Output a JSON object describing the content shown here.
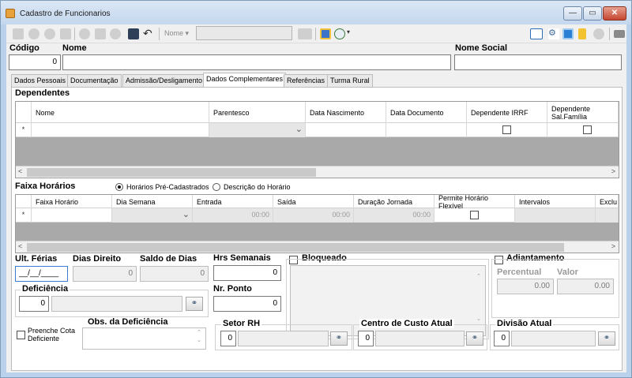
{
  "window": {
    "title": "Cadastro de Funcionarios",
    "min": "—",
    "max": "▭",
    "close": "✕"
  },
  "toolbar": {
    "nome_dropdown": "Nome ▾",
    "search_value": ""
  },
  "header": {
    "codigo_label": "Código",
    "codigo_value": "0",
    "nome_label": "Nome",
    "nome_value": "",
    "nome_social_label": "Nome Social",
    "nome_social_value": ""
  },
  "tabs": [
    "Dados Pessoais",
    "Documentação",
    "Admissão/Desligamento",
    "Dados Complementares",
    "Referências",
    "Turma Rural"
  ],
  "dependentes": {
    "title": "Dependentes",
    "columns": [
      "Nome",
      "Parentesco",
      "Data Nascimento",
      "Data Documento",
      "Dependente IRRF",
      "Dependente Sal.Família"
    ],
    "row_marker": "*"
  },
  "faixa": {
    "title": "Faixa Horários",
    "radio1": "Horários Pré-Cadastrados",
    "radio2": "Descrição do Horário",
    "columns": [
      "Faixa Horário",
      "Dia Semana",
      "Entrada",
      "Saída",
      "Duração Jornada",
      "Permite Horário Flexível",
      "Intervalos",
      "Exclu"
    ],
    "row_marker": "*",
    "entrada": "00:00",
    "saida": "00:00",
    "duracao": "00:00"
  },
  "bottom": {
    "ult_ferias_label": "Ult. Férias",
    "ult_ferias_value": "__/__/____",
    "dias_direito_label": "Dias Direito",
    "dias_direito_value": "0",
    "saldo_label": "Saldo de Dias",
    "saldo_value": "0",
    "hrs_label": "Hrs Semanais",
    "hrs_value": "0",
    "bloqueado_label": "Bloqueado",
    "adiantamento_label": "Adiantamento",
    "percentual_label": "Percentual",
    "percentual_value": "0.00",
    "valor_label": "Valor",
    "valor_value": "0.00",
    "deficiencia_label": "Deficiência",
    "deficiencia_value": "0",
    "nr_ponto_label": "Nr. Ponto",
    "nr_ponto_value": "0",
    "cota_label": "Preenche Cota Deficiente",
    "obs_label": "Obs. da Deficiência",
    "setor_label": "Setor RH",
    "setor_value": "0",
    "centro_label": "Centro de Custo Atual",
    "centro_value": "0",
    "divisao_label": "Divisão Atual",
    "divisao_value": "0"
  }
}
